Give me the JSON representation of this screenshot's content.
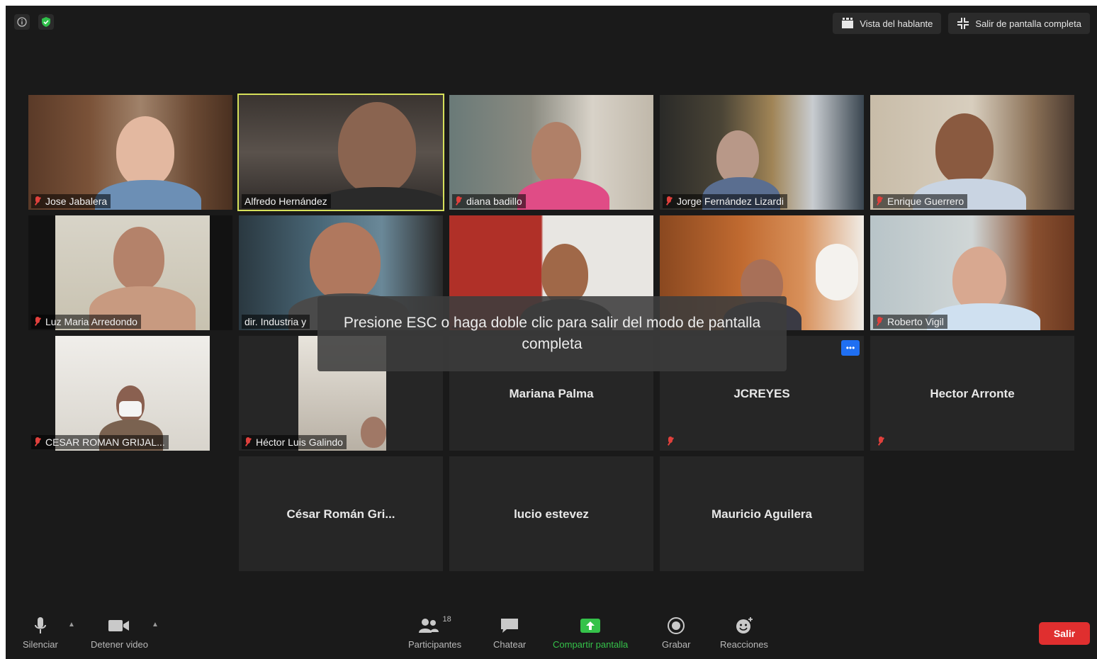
{
  "top_bar": {
    "speaker_view": "Vista del hablante",
    "exit_fullscreen": "Salir de pantalla completa"
  },
  "participants": [
    {
      "name": "Jose Jabalera"
    },
    {
      "name": "Alfredo Hernández"
    },
    {
      "name": "diana badillo"
    },
    {
      "name": "Jorge Fernández Lizardi"
    },
    {
      "name": "Enrique Guerrero"
    },
    {
      "name": "Luz Maria Arredondo"
    },
    {
      "name": "dir. Industria y"
    },
    {
      "name": ""
    },
    {
      "name": ""
    },
    {
      "name": "Roberto Vigil"
    },
    {
      "name": "CESAR ROMAN GRIJAL..."
    },
    {
      "name": "Héctor Luis Galindo"
    },
    {
      "name": "Mariana Palma"
    },
    {
      "name": "JCREYES"
    },
    {
      "name": "Hector Arronte"
    },
    {
      "name": "César Román Gri..."
    },
    {
      "name": "lucio estevez"
    },
    {
      "name": "Mauricio Aguilera"
    }
  ],
  "toast": "Presione ESC o haga doble clic para salir del modo de pantalla completa",
  "toolbar": {
    "mute": "Silenciar",
    "stop_video": "Detener video",
    "participants": "Participantes",
    "participant_count": "18",
    "chat": "Chatear",
    "share_screen": "Compartir pantalla",
    "record": "Grabar",
    "reactions": "Reacciones",
    "leave": "Salir"
  },
  "colors": {
    "active_speaker": "#d6e05a",
    "share_green": "#35c24a",
    "leave_red": "#e02f2f",
    "more_blue": "#1f6ff2"
  }
}
